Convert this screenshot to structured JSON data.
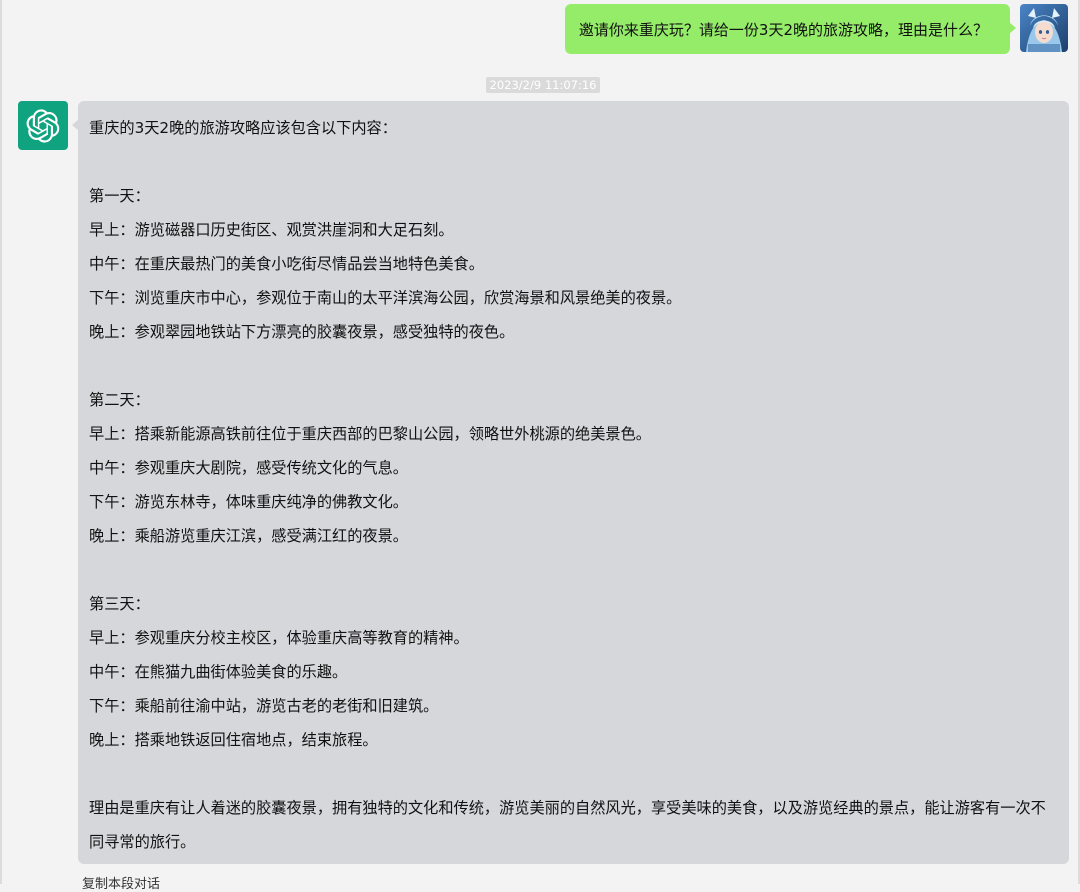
{
  "user_message": {
    "text": "邀请你来重庆玩？请给一份3天2晚的旅游攻略，理由是什么？",
    "avatar": "user-avatar-image"
  },
  "timestamp": "2023/2/9 11:07:16",
  "bot_message": {
    "avatar_icon": "openai-logo-icon",
    "intro": "重庆的3天2晚的旅游攻略应该包含以下内容：",
    "days": [
      {
        "title": "第一天：",
        "items": [
          "早上：游览磁器口历史街区、观赏洪崖洞和大足石刻。",
          "中午：在重庆最热门的美食小吃街尽情品尝当地特色美食。",
          "下午：浏览重庆市中心，参观位于南山的太平洋滨海公园，欣赏海景和风景绝美的夜景。",
          "晚上：参观翠园地铁站下方漂亮的胶囊夜景，感受独特的夜色。"
        ]
      },
      {
        "title": "第二天：",
        "items": [
          "早上：搭乘新能源高铁前往位于重庆西部的巴黎山公园，领略世外桃源的绝美景色。",
          "中午：参观重庆大剧院，感受传统文化的气息。",
          "下午：游览东林寺，体味重庆纯净的佛教文化。",
          "晚上：乘船游览重庆江滨，感受满江红的夜景。"
        ]
      },
      {
        "title": "第三天：",
        "items": [
          "早上：参观重庆分校主校区，体验重庆高等教育的精神。",
          "中午：在熊猫九曲街体验美食的乐趣。",
          "下午：乘船前往渝中站，游览古老的老街和旧建筑。",
          "晚上：搭乘地铁返回住宿地点，结束旅程。"
        ]
      }
    ],
    "conclusion": "理由是重庆有让人着迷的胶囊夜景，拥有独特的文化和传统，游览美丽的自然风光，享受美味的美食，以及游览经典的景点，能让游客有一次不同寻常的旅行。"
  },
  "footer": {
    "copy_label": "复制本段对话"
  },
  "colors": {
    "user_bubble": "#95ec69",
    "bot_bubble": "#d6d7da",
    "bot_avatar": "#10a37f",
    "background": "#f3f3f3"
  }
}
